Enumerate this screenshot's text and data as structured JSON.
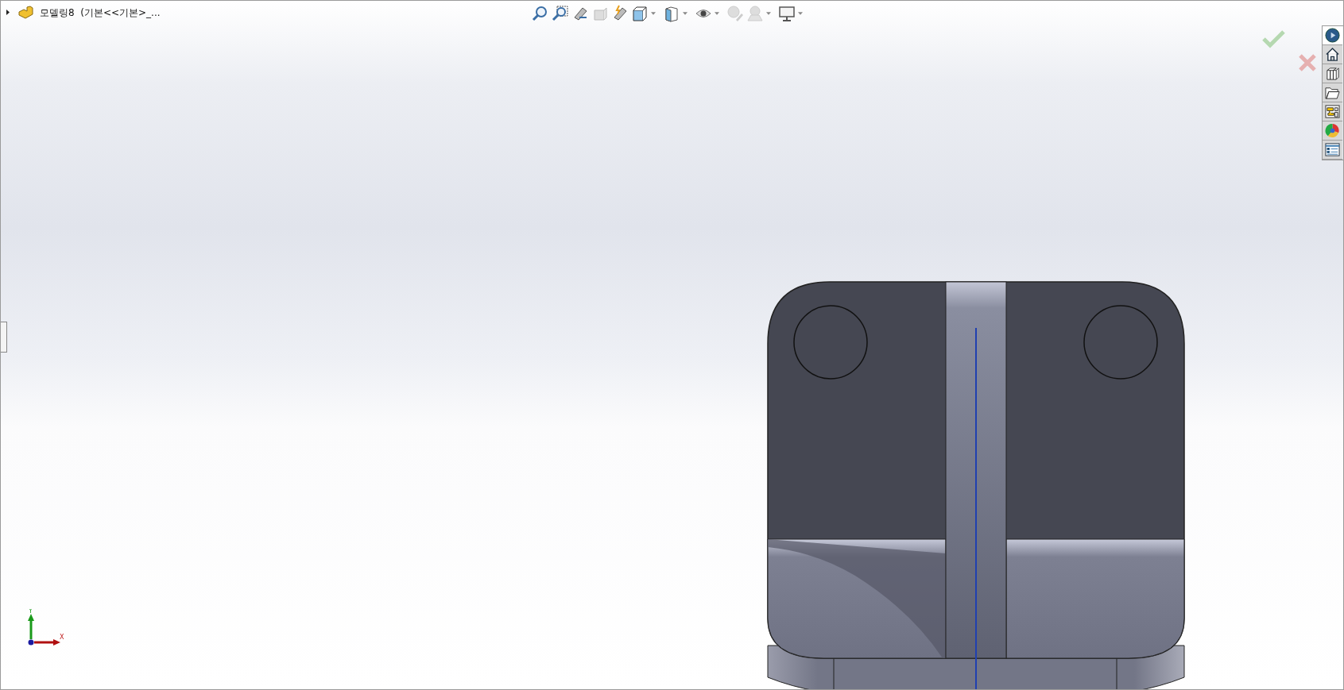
{
  "feature_tree": {
    "label": "모델링8  (기본<<기본>_...",
    "expanded": false
  },
  "triad": {
    "x_label": "X",
    "y_label": "Y"
  }
}
